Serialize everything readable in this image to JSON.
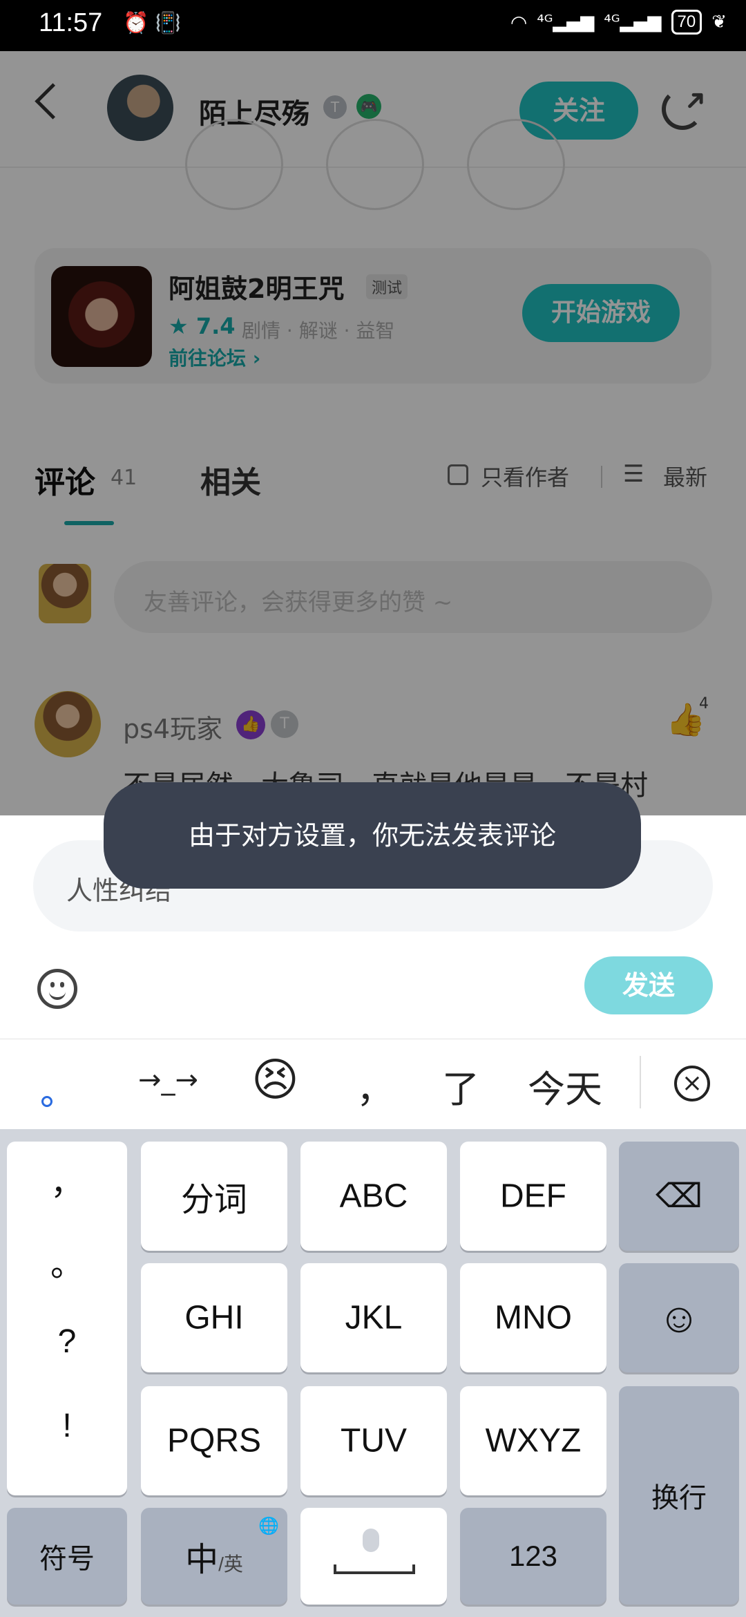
{
  "status_bar": {
    "time": "11:57",
    "left_icons": "⏰ 📳",
    "signal_1": "⁴ᴳ▂▄▆",
    "signal_2": "⁴ᴳ▂▄▆",
    "battery": "70",
    "wifi": "wifi-icon"
  },
  "header": {
    "user_name": "陌上尽殇",
    "badge_t": "T",
    "badge_game": "🎮",
    "follow_label": "关注"
  },
  "game_card": {
    "title": "阿姐鼓2明王咒",
    "tag": "测试",
    "rating": "★ 7.4",
    "tags": "剧情 · 解谜 · 益智",
    "forum_link": "前往论坛 ›",
    "play_label": "开始游戏"
  },
  "tabs": {
    "comments_label": "评论",
    "comments_count": "41",
    "related_label": "相关",
    "author_only_label": "只看作者",
    "sort_label": "最新"
  },
  "comment_box": {
    "placeholder": "友善评论，会获得更多的赞 ~"
  },
  "first_comment": {
    "user": "ps4玩家",
    "likes": "4",
    "text": "不是居然，大鲁司，直就是他是是，不是村"
  },
  "toast": {
    "message": "由于对方设置，你无法发表评论"
  },
  "input_sheet": {
    "text": "人性纠结",
    "send_label": "发送"
  },
  "candidates": [
    "。",
    "→_→",
    "😣",
    "，",
    "了",
    "今天"
  ],
  "keyboard": {
    "punct": [
      "，",
      "。",
      "?",
      "!"
    ],
    "row1": [
      "分词",
      "ABC",
      "DEF"
    ],
    "row2": [
      "GHI",
      "JKL",
      "MNO"
    ],
    "row3": [
      "PQRS",
      "TUV",
      "WXYZ"
    ],
    "delete": "⌫",
    "emoji": "☺",
    "enter": "换行",
    "symbols": "符号",
    "lang_main": "中",
    "lang_sub": "/英",
    "globe": "🌐",
    "numbers": "123"
  }
}
